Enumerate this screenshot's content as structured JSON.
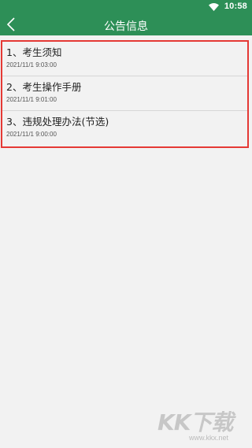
{
  "status_bar": {
    "time": "10:58",
    "wifi_icon": "wifi-icon"
  },
  "app_bar": {
    "title": "公告信息",
    "back_icon": "back-chevron-icon",
    "background_color": "#2d8f57"
  },
  "notices": [
    {
      "title": "1、考生须知",
      "time": "2021/11/1 9:03:00"
    },
    {
      "title": "2、考生操作手册",
      "time": "2021/11/1 9:01:00"
    },
    {
      "title": "3、违规处理办法(节选)",
      "time": "2021/11/1 9:00:00"
    }
  ],
  "highlight_color": "#e53935",
  "watermark": {
    "logo": "KK下载",
    "url": "www.kkx.net"
  }
}
